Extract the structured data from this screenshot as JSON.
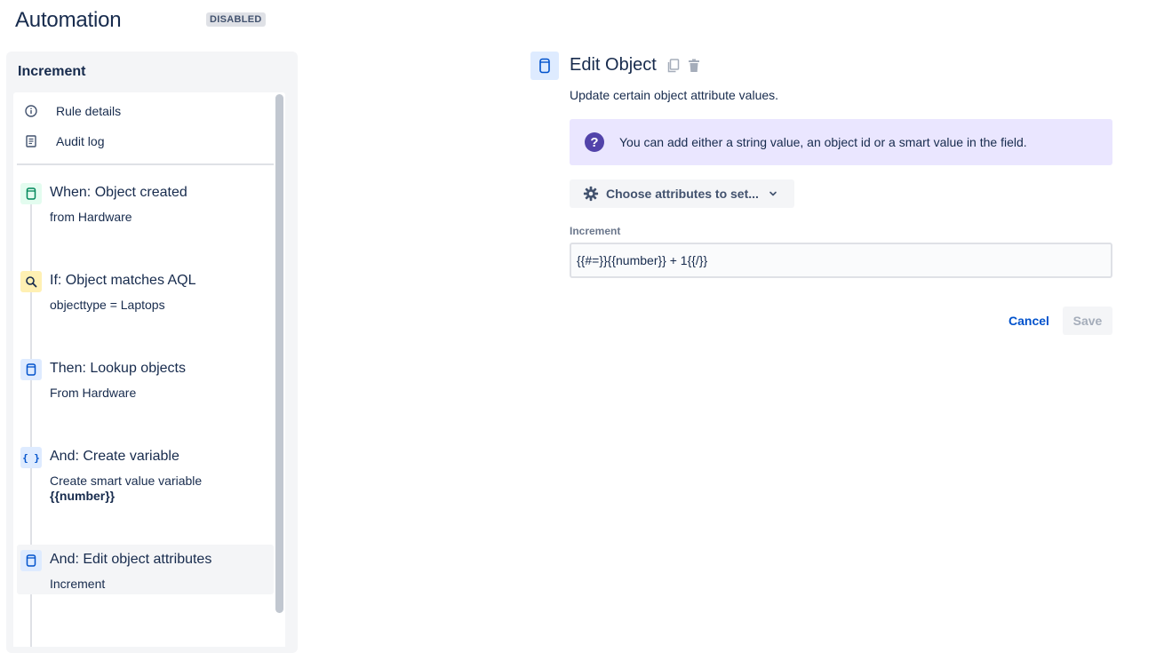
{
  "app": {
    "title": "Automation",
    "status_badge": "DISABLED"
  },
  "sidebar": {
    "title": "Increment",
    "menu": [
      {
        "label": "Rule details",
        "icon": "info-icon"
      },
      {
        "label": "Audit log",
        "icon": "document-icon"
      }
    ],
    "steps": [
      {
        "title": "When: Object created",
        "subtitle": "from Hardware",
        "icon": "object-icon",
        "color": "#e3fcef"
      },
      {
        "title": "If: Object matches AQL",
        "subtitle": "objecttype = Laptops",
        "icon": "search-icon",
        "color": "#fff0b3"
      },
      {
        "title": "Then: Lookup objects",
        "subtitle": "From Hardware",
        "icon": "object-icon",
        "color": "#deebff"
      },
      {
        "title": "And: Create variable",
        "subtitle": "Create smart value variable",
        "subtitle_bold": "{{number}}",
        "icon": "braces-icon",
        "color": "#deebff"
      },
      {
        "title": "And: Edit object attributes",
        "subtitle": "Increment",
        "icon": "object-icon",
        "color": "#deebff",
        "selected": true
      }
    ]
  },
  "main": {
    "title": "Edit Object",
    "description": "Update certain object attribute values.",
    "info_text": "You can add either a string value, an object id or a smart value in the field.",
    "choose_label": "Choose attributes to set...",
    "field_label": "Increment",
    "field_value": "{{#=}}{{number}} + 1{{/}}",
    "cancel_label": "Cancel",
    "save_label": "Save"
  },
  "colors": {
    "accent": "#0052cc",
    "info_bg": "#eae6ff",
    "info_icon": "#5243aa"
  }
}
